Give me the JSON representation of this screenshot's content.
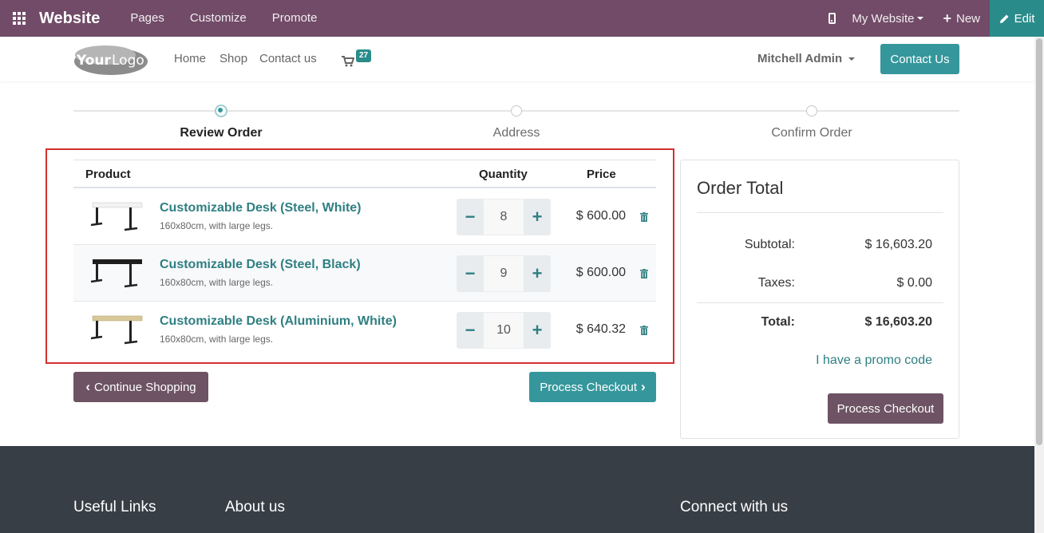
{
  "topbar": {
    "brand": "Website",
    "menu": [
      "Pages",
      "Customize",
      "Promote"
    ],
    "site_selector": "My Website",
    "new_label": "New",
    "edit_label": "Edit",
    "accent_color": "#714b67",
    "edit_color": "#2a8c8a"
  },
  "header": {
    "logo_text": "YourLogo",
    "nav": [
      "Home",
      "Shop",
      "Contact us"
    ],
    "cart_count": "27",
    "user_name": "Mitchell Admin",
    "contact_button": "Contact Us"
  },
  "progress": {
    "steps": [
      "Review Order",
      "Address",
      "Confirm Order"
    ],
    "active_step": 0
  },
  "cart": {
    "headers": {
      "product": "Product",
      "quantity": "Quantity",
      "price": "Price"
    },
    "items": [
      {
        "name": "Customizable Desk (Steel, White)",
        "desc": "160x80cm, with large legs.",
        "qty": "8",
        "price": "$ 600.00",
        "top_color": "#f2f2f2"
      },
      {
        "name": "Customizable Desk (Steel, Black)",
        "desc": "160x80cm, with large legs.",
        "qty": "9",
        "price": "$ 600.00",
        "top_color": "#1e1e1e"
      },
      {
        "name": "Customizable Desk (Aluminium, White)",
        "desc": "160x80cm, with large legs.",
        "qty": "10",
        "price": "$ 640.32",
        "top_color": "#d8c89a"
      }
    ],
    "continue_label": "Continue Shopping",
    "checkout_label": "Process Checkout"
  },
  "order_total": {
    "title": "Order Total",
    "subtotal_label": "Subtotal:",
    "subtotal_value": "$ 16,603.20",
    "taxes_label": "Taxes:",
    "taxes_value": "$ 0.00",
    "total_label": "Total:",
    "total_value": "$ 16,603.20",
    "promo_label": "I have a promo code",
    "checkout_label": "Process Checkout"
  },
  "footer": {
    "headings": [
      "Useful Links",
      "About us",
      "Connect with us"
    ]
  }
}
